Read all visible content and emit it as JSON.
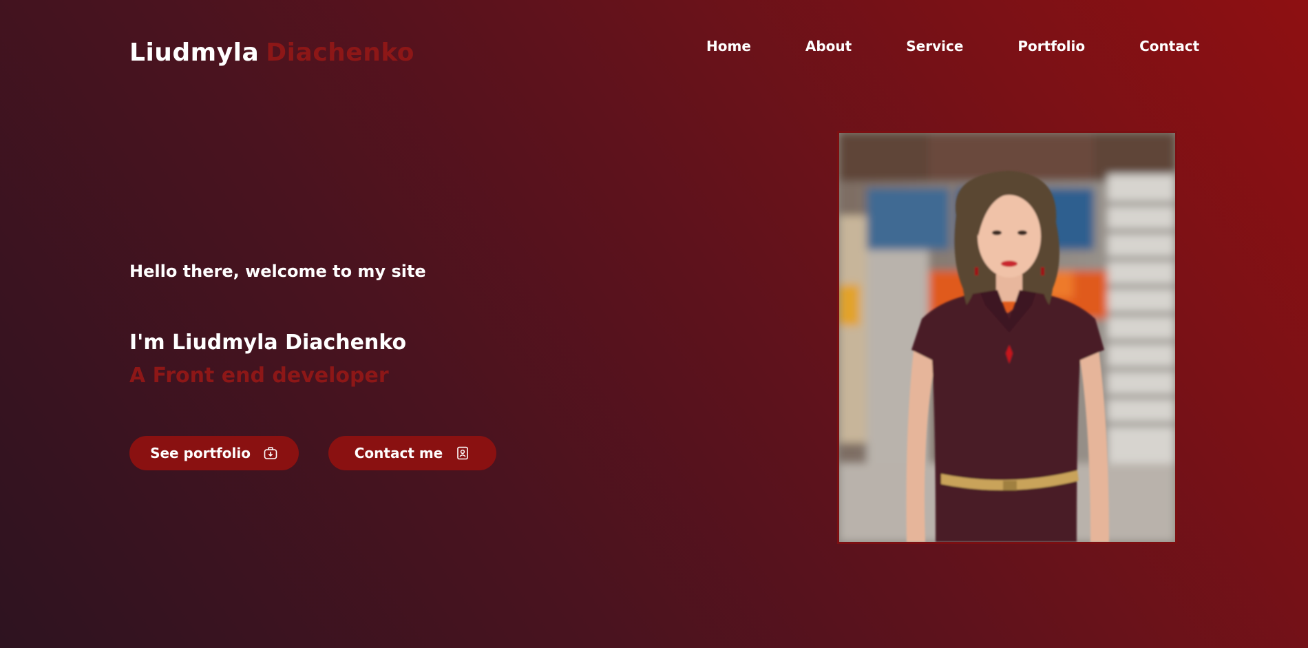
{
  "logo": {
    "first": "Liudmyla",
    "last": "Diachenko"
  },
  "nav": {
    "home": "Home",
    "about": "About",
    "service": "Service",
    "portfolio": "Portfolio",
    "contact": "Contact"
  },
  "hero": {
    "greeting": "Hello there, welcome to my site",
    "name": "I'm Liudmyla Diachenko",
    "role": "A Front end developer"
  },
  "buttons": {
    "portfolio": {
      "label": "See portfolio",
      "icon": "briefcase-icon"
    },
    "contact": {
      "label": "Contact me",
      "icon": "contact-card-icon"
    }
  },
  "colors": {
    "accent": "#8d1717",
    "button": "#8a1111",
    "text": "#ffffff"
  }
}
